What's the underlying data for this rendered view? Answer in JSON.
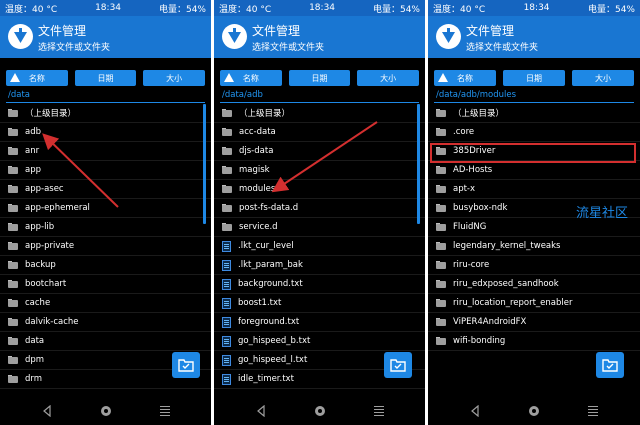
{
  "status": {
    "temp": "温度：40 °C",
    "time": "18:34",
    "battery": "电量：54%"
  },
  "header": {
    "title": "文件管理",
    "subtitle": "选择文件或文件夹"
  },
  "sort": {
    "name": "名称",
    "date": "日期",
    "size": "大小"
  },
  "screens": [
    {
      "path": "/data",
      "items": [
        {
          "name": "（上级目录）",
          "type": "folder"
        },
        {
          "name": "adb",
          "type": "folder"
        },
        {
          "name": "anr",
          "type": "folder"
        },
        {
          "name": "app",
          "type": "folder"
        },
        {
          "name": "app-asec",
          "type": "folder"
        },
        {
          "name": "app-ephemeral",
          "type": "folder"
        },
        {
          "name": "app-lib",
          "type": "folder"
        },
        {
          "name": "app-private",
          "type": "folder"
        },
        {
          "name": "backup",
          "type": "folder"
        },
        {
          "name": "bootchart",
          "type": "folder"
        },
        {
          "name": "cache",
          "type": "folder"
        },
        {
          "name": "dalvik-cache",
          "type": "folder"
        },
        {
          "name": "data",
          "type": "folder"
        },
        {
          "name": "dpm",
          "type": "folder"
        },
        {
          "name": "drm",
          "type": "folder"
        }
      ]
    },
    {
      "path": "/data/adb",
      "items": [
        {
          "name": "（上级目录）",
          "type": "folder"
        },
        {
          "name": "acc-data",
          "type": "folder"
        },
        {
          "name": "djs-data",
          "type": "folder"
        },
        {
          "name": "magisk",
          "type": "folder"
        },
        {
          "name": "modules",
          "type": "folder"
        },
        {
          "name": "post-fs-data.d",
          "type": "folder"
        },
        {
          "name": "service.d",
          "type": "folder"
        },
        {
          "name": ".lkt_cur_level",
          "type": "file"
        },
        {
          "name": ".lkt_param_bak",
          "type": "file"
        },
        {
          "name": "background.txt",
          "type": "file"
        },
        {
          "name": "boost1.txt",
          "type": "file"
        },
        {
          "name": "foreground.txt",
          "type": "file"
        },
        {
          "name": "go_hispeed_b.txt",
          "type": "file"
        },
        {
          "name": "go_hispeed_l.txt",
          "type": "file"
        },
        {
          "name": "idle_timer.txt",
          "type": "file"
        }
      ]
    },
    {
      "path": "/data/adb/modules",
      "items": [
        {
          "name": "（上级目录）",
          "type": "folder"
        },
        {
          "name": ".core",
          "type": "folder"
        },
        {
          "name": "385Driver",
          "type": "folder"
        },
        {
          "name": "AD-Hosts",
          "type": "folder"
        },
        {
          "name": "apt-x",
          "type": "folder"
        },
        {
          "name": "busybox-ndk",
          "type": "folder"
        },
        {
          "name": "FluidNG",
          "type": "folder"
        },
        {
          "name": "legendary_kernel_tweaks",
          "type": "folder"
        },
        {
          "name": "riru-core",
          "type": "folder"
        },
        {
          "name": "riru_edxposed_sandhook",
          "type": "folder"
        },
        {
          "name": "riru_location_report_enabler",
          "type": "folder"
        },
        {
          "name": "ViPER4AndroidFX",
          "type": "folder"
        },
        {
          "name": "wifi-bonding",
          "type": "folder"
        }
      ]
    }
  ],
  "watermark": "流星社区",
  "colors": {
    "accent": "#1976d2",
    "annotation": "#d32f2f"
  }
}
